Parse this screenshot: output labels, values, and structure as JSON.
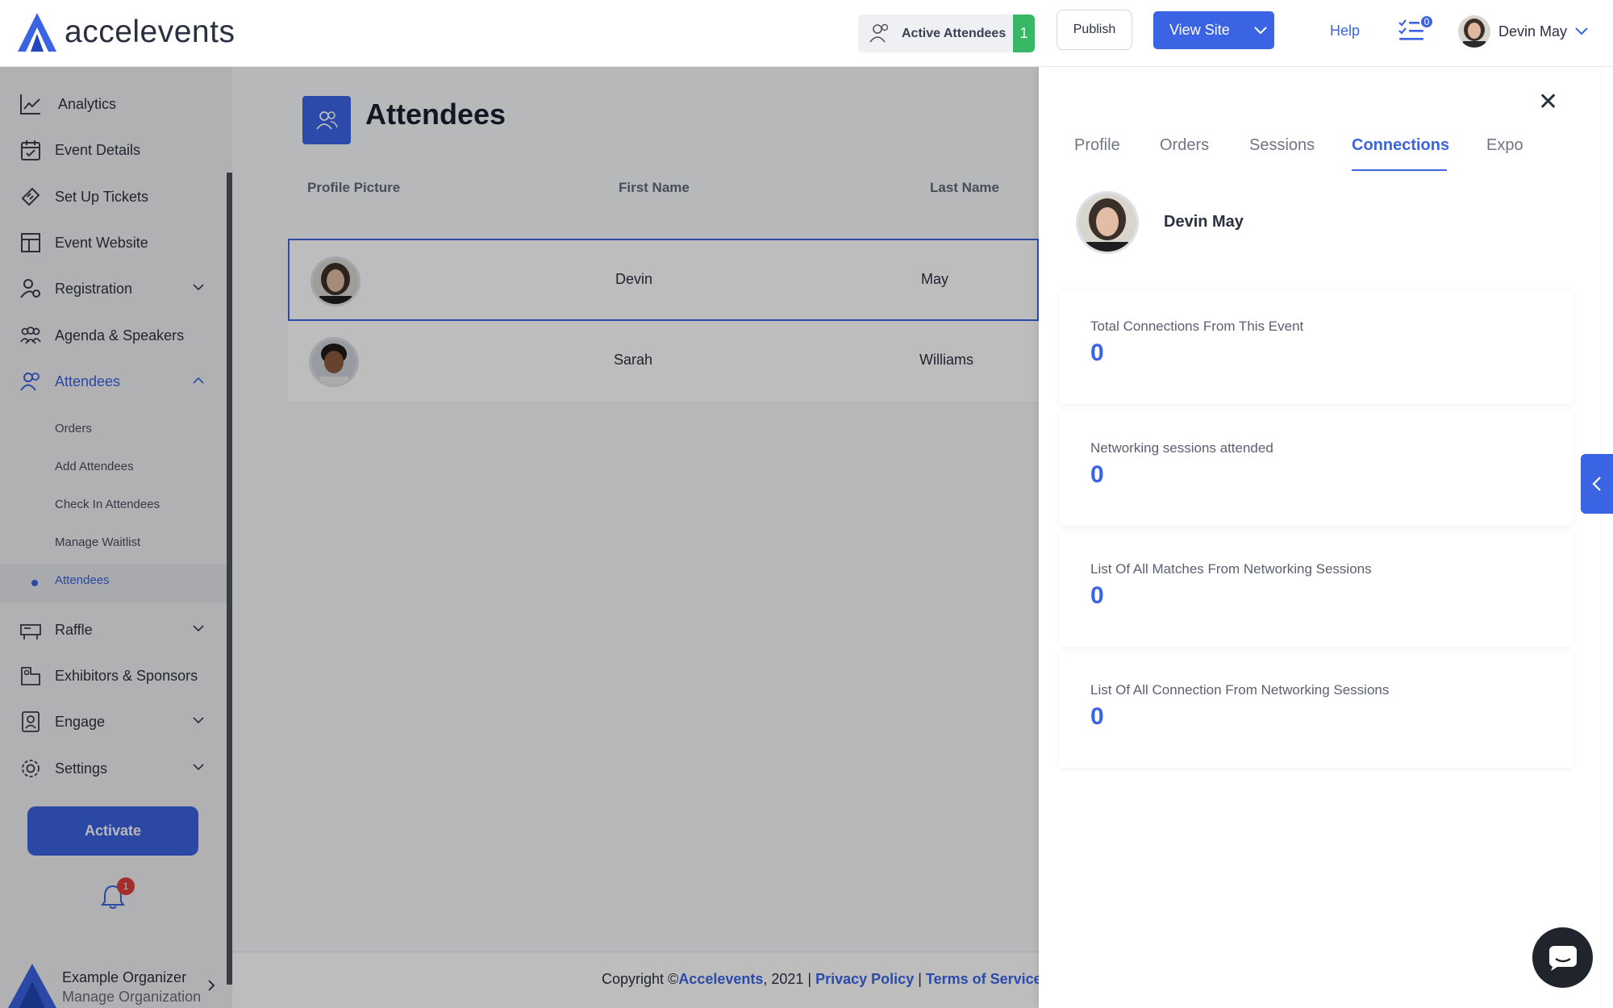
{
  "app": {
    "logo_text": "accelevents"
  },
  "topbar": {
    "active_attendees_label": "Active Attendees",
    "active_attendees_count": "1",
    "publish_label": "Publish",
    "view_site_label": "View Site",
    "help_label": "Help",
    "tasks_count": "0",
    "user_name": "Devin May"
  },
  "sidebar": {
    "items": [
      {
        "label": "Analytics",
        "icon": "chart-line-icon"
      },
      {
        "label": "Event Details",
        "icon": "calendar-icon"
      },
      {
        "label": "Set Up Tickets",
        "icon": "ticket-icon"
      },
      {
        "label": "Event Website",
        "icon": "layout-icon"
      },
      {
        "label": "Registration",
        "icon": "registration-icon"
      },
      {
        "label": "Agenda & Speakers",
        "icon": "people-icon"
      },
      {
        "label": "Attendees",
        "icon": "attendees-icon"
      },
      {
        "label": "Raffle",
        "icon": "raffle-icon"
      },
      {
        "label": "Exhibitors & Sponsors",
        "icon": "exhibitor-icon"
      },
      {
        "label": "Engage",
        "icon": "engage-icon"
      },
      {
        "label": "Settings",
        "icon": "gear-icon"
      }
    ],
    "sub_items": [
      "Orders",
      "Add Attendees",
      "Check In Attendees",
      "Manage Waitlist",
      "Attendees"
    ],
    "activate_label": "Activate",
    "notifications_count": "1",
    "org_name": "Example Organizer",
    "org_sub": "Manage Organization"
  },
  "main": {
    "title": "Attendees",
    "columns": [
      "Profile Picture",
      "First Name",
      "Last Name"
    ],
    "rows": [
      {
        "first": "Devin",
        "last": "May"
      },
      {
        "first": "Sarah",
        "last": "Williams"
      }
    ],
    "footer": {
      "copyright": "Copyright ©",
      "brand": "Accelevents",
      "year": ", 2021 | ",
      "privacy": "Privacy Policy",
      "sep": " | ",
      "terms": "Terms of Service"
    }
  },
  "panel": {
    "tabs": [
      "Profile",
      "Orders",
      "Sessions",
      "Connections",
      "Expo"
    ],
    "active_tab": "Connections",
    "name": "Devin May",
    "stats": [
      {
        "label": "Total Connections From This Event",
        "value": "0"
      },
      {
        "label": "Networking sessions attended",
        "value": "0"
      },
      {
        "label": "List Of All Matches From Networking Sessions",
        "value": "0"
      },
      {
        "label": "List Of All Connection From Networking Sessions",
        "value": "0"
      }
    ]
  },
  "colors": {
    "accent": "#3b64e4",
    "success": "#38b764",
    "danger": "#e53e3e"
  }
}
